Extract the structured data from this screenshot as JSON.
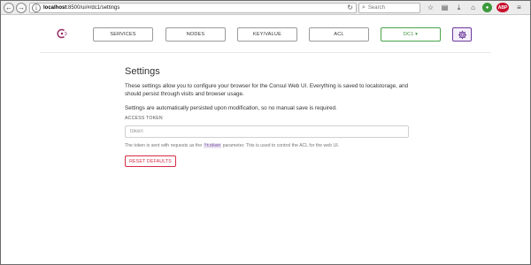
{
  "browser": {
    "url_host": "localhost",
    "url_path": ":8500/ui/#/dc1/settings",
    "search_placeholder": "Search",
    "back_glyph": "←",
    "forward_glyph": "→",
    "icons": [
      "info-icon",
      "reload-icon",
      "search-icon",
      "bookmark-star-icon",
      "reading-list-icon",
      "download-icon",
      "home-icon",
      "green-extension-icon",
      "adblock-icon",
      "menu-icon"
    ]
  },
  "header": {
    "tabs": [
      {
        "label": "SERVICES"
      },
      {
        "label": "NODES"
      },
      {
        "label": "KEY/VALUE"
      },
      {
        "label": "ACL"
      },
      {
        "label": "DC1 ▾"
      }
    ],
    "logo_color": "#962d68",
    "settings_accent": "#6c3b9c"
  },
  "settings": {
    "title": "Settings",
    "description": "These settings allow you to configure your browser for the Consul Web UI. Everything is saved to localstorage, and should persist through visits and browser usage.",
    "persist_note": "Settings are automatically persisted upon modification, so no manual save is required.",
    "access_token_label": "ACCESS TOKEN",
    "token_placeholder": "token",
    "token_value": "",
    "help_prefix": "The token is sent with requests as the ",
    "help_code": "?token",
    "help_suffix": " parameter. This is used to control the ACL for the web UI.",
    "reset_label": "RESET DEFAULTS",
    "reset_color": "#d62b45"
  }
}
